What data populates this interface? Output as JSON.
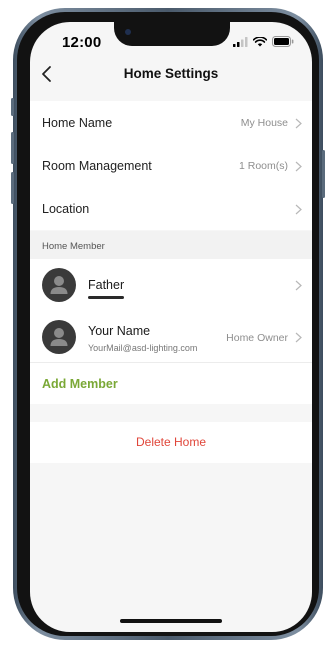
{
  "status_bar": {
    "time": "12:00"
  },
  "header": {
    "title": "Home Settings"
  },
  "settings": [
    {
      "label": "Home Name",
      "value": "My House"
    },
    {
      "label": "Room Management",
      "value": "1 Room(s)"
    },
    {
      "label": "Location",
      "value": ""
    }
  ],
  "members_section": {
    "header": "Home Member",
    "members": [
      {
        "name": "Father",
        "email": "",
        "role": ""
      },
      {
        "name": "Your Name",
        "email": "YourMail@asd-lighting.com",
        "role": "Home Owner"
      }
    ],
    "add_label": "Add Member"
  },
  "delete_label": "Delete Home",
  "colors": {
    "accent_green": "#7aa836",
    "danger_red": "#e0463a"
  },
  "icons": {
    "back": "chevron-left-icon",
    "row_chevron": "chevron-right-icon",
    "avatar": "user-silhouette-icon",
    "signal": "signal-icon",
    "wifi": "wifi-icon",
    "battery": "battery-icon"
  }
}
